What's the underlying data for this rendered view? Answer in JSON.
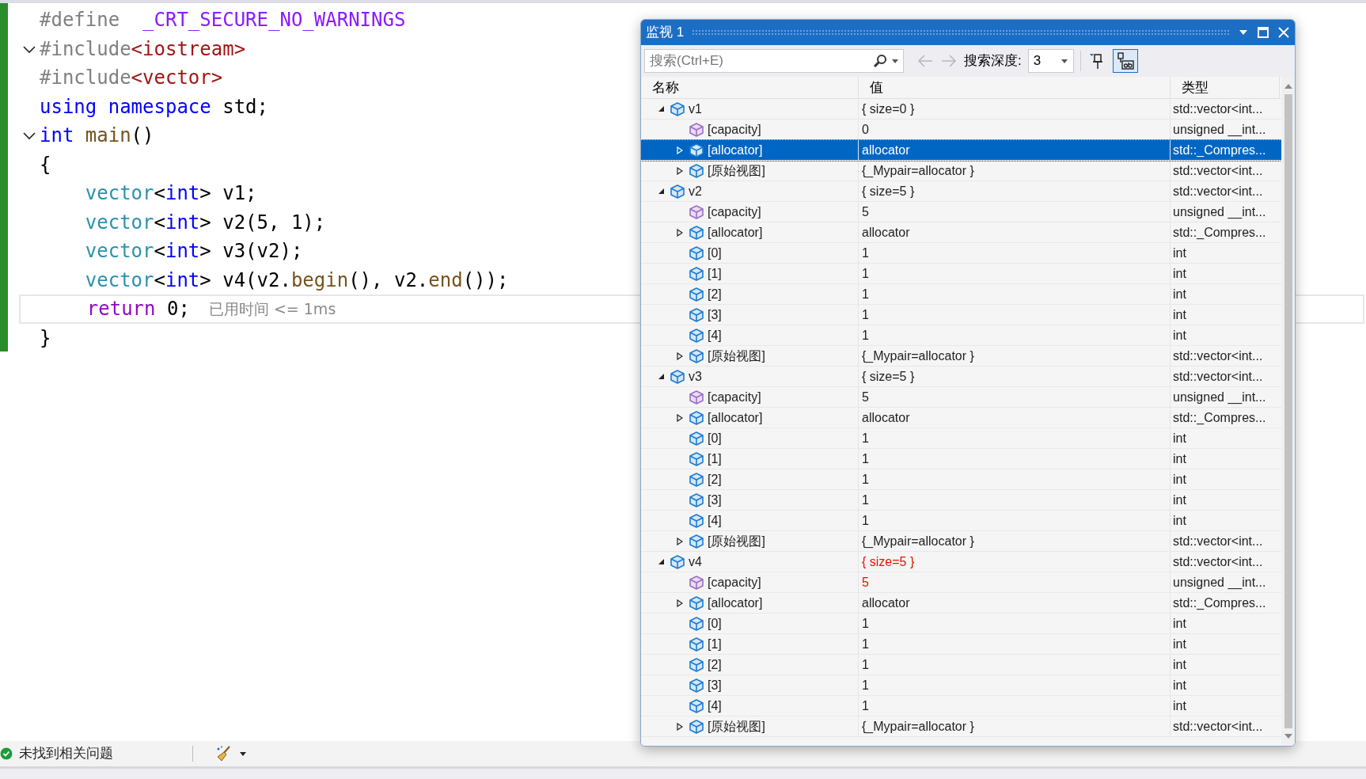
{
  "editor": {
    "lines": [
      {
        "tokens": [
          {
            "text": "#define  ",
            "kind": "preproc"
          },
          {
            "text": "_CRT_SECURE_NO_WARNINGS",
            "kind": "macro"
          }
        ]
      },
      {
        "folded": false,
        "tokens": [
          {
            "text": "#include",
            "kind": "preproc"
          },
          {
            "text": "<iostream>",
            "kind": "string"
          }
        ]
      },
      {
        "tokens": [
          {
            "text": "#include",
            "kind": "preproc"
          },
          {
            "text": "<vector>",
            "kind": "string"
          }
        ]
      },
      {
        "tokens": [
          {
            "text": "using",
            "kind": "keyword"
          },
          {
            "text": " namespace",
            "kind": "keyword"
          },
          {
            "text": " std;",
            "kind": "plain"
          }
        ]
      },
      {
        "folded": false,
        "tokens": [
          {
            "text": "int",
            "kind": "keyword"
          },
          {
            "text": " main",
            "kind": "function"
          },
          {
            "text": "()",
            "kind": "plain"
          }
        ]
      },
      {
        "tokens": [
          {
            "text": "{",
            "kind": "plain"
          }
        ]
      },
      {
        "tokens": [
          {
            "text": "    vector",
            "kind": "type"
          },
          {
            "text": "<",
            "kind": "plain"
          },
          {
            "text": "int",
            "kind": "keyword"
          },
          {
            "text": "> v1;",
            "kind": "plain"
          }
        ]
      },
      {
        "tokens": [
          {
            "text": "    vector",
            "kind": "type"
          },
          {
            "text": "<",
            "kind": "plain"
          },
          {
            "text": "int",
            "kind": "keyword"
          },
          {
            "text": "> v2(5, 1);",
            "kind": "plain"
          }
        ]
      },
      {
        "tokens": [
          {
            "text": "    vector",
            "kind": "type"
          },
          {
            "text": "<",
            "kind": "plain"
          },
          {
            "text": "int",
            "kind": "keyword"
          },
          {
            "text": "> v3(v2);",
            "kind": "plain"
          }
        ]
      },
      {
        "tokens": [
          {
            "text": "    vector",
            "kind": "type"
          },
          {
            "text": "<",
            "kind": "plain"
          },
          {
            "text": "int",
            "kind": "keyword"
          },
          {
            "text": "> v4(v2.",
            "kind": "plain"
          },
          {
            "text": "begin",
            "kind": "function"
          },
          {
            "text": "(), v2.",
            "kind": "plain"
          },
          {
            "text": "end",
            "kind": "function"
          },
          {
            "text": "());",
            "kind": "plain"
          }
        ]
      },
      {
        "current": true,
        "hint": "已用时间 <= 1ms",
        "tokens": [
          {
            "text": "    return",
            "kind": "control"
          },
          {
            "text": " 0;",
            "kind": "plain"
          }
        ]
      },
      {
        "tokens": [
          {
            "text": "}",
            "kind": "plain"
          }
        ]
      }
    ]
  },
  "watch": {
    "title": "监视 1",
    "search": {
      "placeholder": "搜索(Ctrl+E)"
    },
    "depth_label": "搜索深度:",
    "depth": "3",
    "columns": [
      "名称",
      "值",
      "类型"
    ],
    "rows": [
      {
        "name": "v1",
        "value": "{ size=0 }",
        "type": "std::vector<int...",
        "kind": "object",
        "expanded": true,
        "selected": false,
        "changed": false,
        "children": [
          {
            "name": "[capacity]",
            "value": "0",
            "type": "unsigned __int...",
            "kind": "property",
            "selected": false,
            "changed": false
          },
          {
            "name": "[allocator]",
            "value": "allocator",
            "type": "std::_Compres...",
            "kind": "object",
            "expanded": false,
            "selected": true,
            "changed": false
          },
          {
            "name": "[原始视图]",
            "value": "{_Mypair=allocator }",
            "type": "std::vector<int...",
            "kind": "object",
            "expanded": false,
            "selected": false,
            "changed": false
          }
        ]
      },
      {
        "name": "v2",
        "value": "{ size=5 }",
        "type": "std::vector<int...",
        "kind": "object",
        "expanded": true,
        "selected": false,
        "changed": false,
        "children": [
          {
            "name": "[capacity]",
            "value": "5",
            "type": "unsigned __int...",
            "kind": "property",
            "selected": false,
            "changed": false
          },
          {
            "name": "[allocator]",
            "value": "allocator",
            "type": "std::_Compres...",
            "kind": "object",
            "expanded": false,
            "selected": false,
            "changed": false
          },
          {
            "name": "[0]",
            "value": "1",
            "type": "int",
            "kind": "object",
            "selected": false,
            "changed": false
          },
          {
            "name": "[1]",
            "value": "1",
            "type": "int",
            "kind": "object",
            "selected": false,
            "changed": false
          },
          {
            "name": "[2]",
            "value": "1",
            "type": "int",
            "kind": "object",
            "selected": false,
            "changed": false
          },
          {
            "name": "[3]",
            "value": "1",
            "type": "int",
            "kind": "object",
            "selected": false,
            "changed": false
          },
          {
            "name": "[4]",
            "value": "1",
            "type": "int",
            "kind": "object",
            "selected": false,
            "changed": false
          },
          {
            "name": "[原始视图]",
            "value": "{_Mypair=allocator }",
            "type": "std::vector<int...",
            "kind": "object",
            "expanded": false,
            "selected": false,
            "changed": false
          }
        ]
      },
      {
        "name": "v3",
        "value": "{ size=5 }",
        "type": "std::vector<int...",
        "kind": "object",
        "expanded": true,
        "selected": false,
        "changed": false,
        "children": [
          {
            "name": "[capacity]",
            "value": "5",
            "type": "unsigned __int...",
            "kind": "property",
            "selected": false,
            "changed": false
          },
          {
            "name": "[allocator]",
            "value": "allocator",
            "type": "std::_Compres...",
            "kind": "object",
            "expanded": false,
            "selected": false,
            "changed": false
          },
          {
            "name": "[0]",
            "value": "1",
            "type": "int",
            "kind": "object",
            "selected": false,
            "changed": false
          },
          {
            "name": "[1]",
            "value": "1",
            "type": "int",
            "kind": "object",
            "selected": false,
            "changed": false
          },
          {
            "name": "[2]",
            "value": "1",
            "type": "int",
            "kind": "object",
            "selected": false,
            "changed": false
          },
          {
            "name": "[3]",
            "value": "1",
            "type": "int",
            "kind": "object",
            "selected": false,
            "changed": false
          },
          {
            "name": "[4]",
            "value": "1",
            "type": "int",
            "kind": "object",
            "selected": false,
            "changed": false
          },
          {
            "name": "[原始视图]",
            "value": "{_Mypair=allocator }",
            "type": "std::vector<int...",
            "kind": "object",
            "expanded": false,
            "selected": false,
            "changed": false
          }
        ]
      },
      {
        "name": "v4",
        "value": "{ size=5 }",
        "type": "std::vector<int...",
        "kind": "object",
        "expanded": true,
        "selected": false,
        "changed": true,
        "children": [
          {
            "name": "[capacity]",
            "value": "5",
            "type": "unsigned __int...",
            "kind": "property",
            "selected": false,
            "changed": true
          },
          {
            "name": "[allocator]",
            "value": "allocator",
            "type": "std::_Compres...",
            "kind": "object",
            "expanded": false,
            "selected": false,
            "changed": false
          },
          {
            "name": "[0]",
            "value": "1",
            "type": "int",
            "kind": "object",
            "selected": false,
            "changed": false
          },
          {
            "name": "[1]",
            "value": "1",
            "type": "int",
            "kind": "object",
            "selected": false,
            "changed": false
          },
          {
            "name": "[2]",
            "value": "1",
            "type": "int",
            "kind": "object",
            "selected": false,
            "changed": false
          },
          {
            "name": "[3]",
            "value": "1",
            "type": "int",
            "kind": "object",
            "selected": false,
            "changed": false
          },
          {
            "name": "[4]",
            "value": "1",
            "type": "int",
            "kind": "object",
            "selected": false,
            "changed": false
          },
          {
            "name": "[原始视图]",
            "value": "{_Mypair=allocator }",
            "type": "std::vector<int...",
            "kind": "object",
            "expanded": false,
            "selected": false,
            "changed": false
          }
        ]
      }
    ]
  },
  "status_bar": {
    "message": "未找到相关问题"
  }
}
